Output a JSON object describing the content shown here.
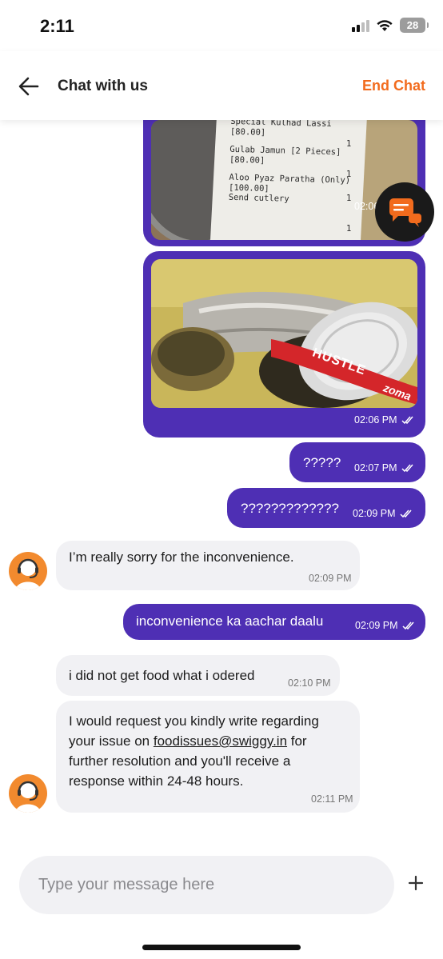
{
  "status_bar": {
    "time": "2:11",
    "battery": "28"
  },
  "header": {
    "title": "Chat with us",
    "end_chat_label": "End Chat"
  },
  "messages": [
    {
      "type": "image-out",
      "receipt_lines": [
        "Special Kulhad Lassi",
        "[80.00]",
        "Gulab Jamun [2 Pieces]",
        "[80.00]",
        "Aloo Pyaz Paratha (Only)",
        "[100.00]",
        "Send cutlery"
      ],
      "receipt_qty": [
        "1",
        "1",
        "1",
        "1"
      ],
      "time": "02:06 PM"
    },
    {
      "type": "image-out",
      "photo_text": [
        "HUSTLE",
        "zoma"
      ],
      "time": "02:06 PM"
    },
    {
      "type": "text-out",
      "text": "?????",
      "time": "02:07 PM"
    },
    {
      "type": "text-out",
      "text": "?????????????",
      "time": "02:09 PM"
    },
    {
      "type": "text-in",
      "text": "I’m really sorry for the inconvenience.",
      "time": "02:09 PM"
    },
    {
      "type": "text-out",
      "text": "inconvenience ka aachar daalu",
      "time": "02:09 PM"
    },
    {
      "type": "text-in",
      "text": "i did not get food what i odered",
      "time": "02:10 PM"
    },
    {
      "type": "text-in",
      "text_lines": [
        "I would request you kindly write regarding",
        "your issue on ",
        "foodissues@swiggy.in",
        " for",
        "further resolution and you'll receive a",
        "response within 24-48 hours."
      ],
      "time": "02:11 PM"
    }
  ],
  "composer": {
    "placeholder": "Type your message here"
  },
  "icons": {
    "back": "arrow-left-icon",
    "fab": "chat-bubbles-icon",
    "plus": "plus-icon",
    "avatar": "support-agent-headset-icon",
    "ticks": "double-check-icon"
  },
  "colors": {
    "accent": "#f26b1d",
    "bubble_out": "#4e2fb4",
    "bubble_in": "#f1f1f4",
    "avatar": "#f28a2e"
  }
}
